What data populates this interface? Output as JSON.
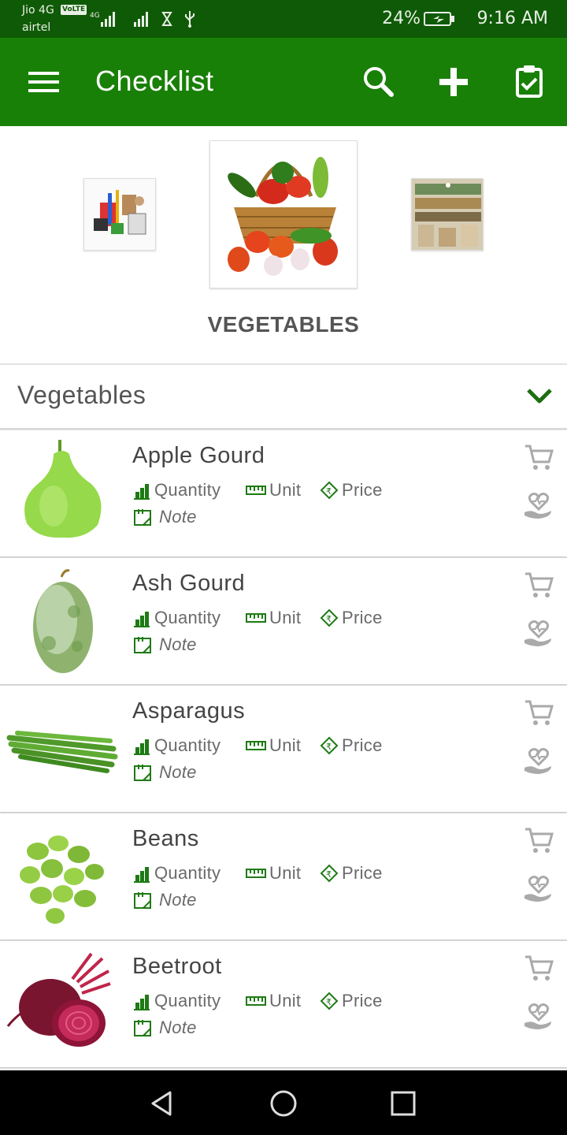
{
  "status_bar": {
    "carrier_1": "Jio 4G",
    "volte": "VoLTE",
    "carrier_2": "airtel",
    "battery": "24%",
    "time": "9:16 AM"
  },
  "app_bar": {
    "title": "Checklist"
  },
  "carousel": {
    "category_title": "VEGETABLES"
  },
  "dropdown": {
    "selected": "Vegetables"
  },
  "field_labels": {
    "quantity": "Quantity",
    "unit": "Unit",
    "price": "Price",
    "note": "Note"
  },
  "items": [
    {
      "name": "Apple Gourd"
    },
    {
      "name": "Ash Gourd"
    },
    {
      "name": "Asparagus"
    },
    {
      "name": "Beans"
    },
    {
      "name": "Beetroot"
    }
  ],
  "colors": {
    "status_bar": "#0f5a06",
    "app_bar": "#198007",
    "accent_green": "#1e7a14"
  }
}
